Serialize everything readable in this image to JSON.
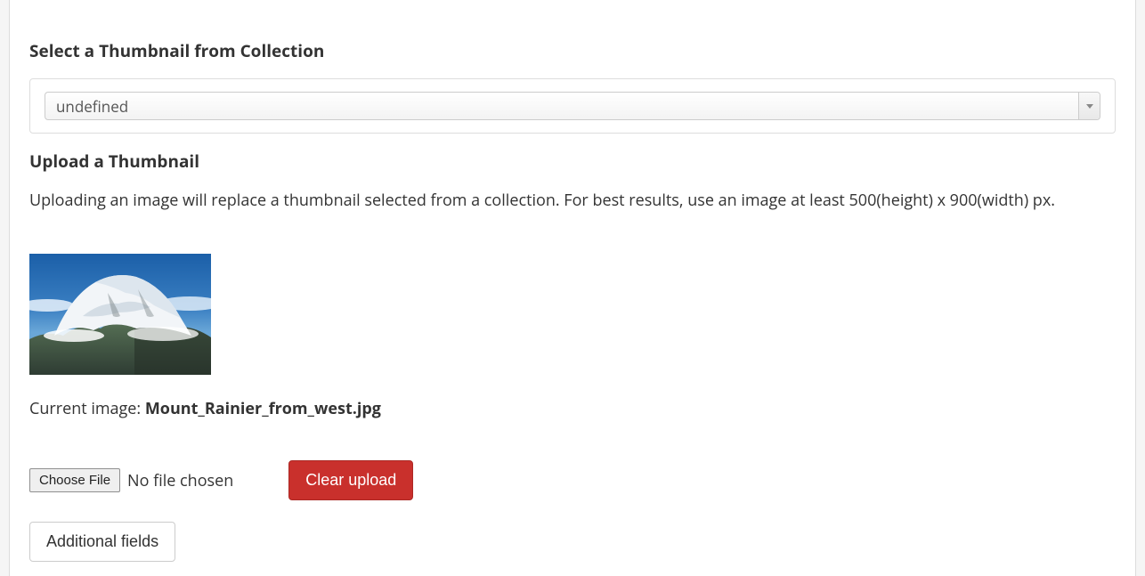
{
  "sections": {
    "select_thumbnail": {
      "heading": "Select a Thumbnail from Collection",
      "combo_value": "undefined"
    },
    "upload_thumbnail": {
      "heading": "Upload a Thumbnail",
      "help_text": "Uploading an image will replace a thumbnail selected from a collection. For best results, use an image at least 500(height) x 900(width) px.",
      "current_image_label": "Current image: ",
      "current_image_filename": "Mount_Rainier_from_west.jpg",
      "choose_file_label": "Choose File",
      "no_file_chosen_label": "No file chosen",
      "clear_upload_label": "Clear upload",
      "additional_fields_label": "Additional fields"
    }
  }
}
